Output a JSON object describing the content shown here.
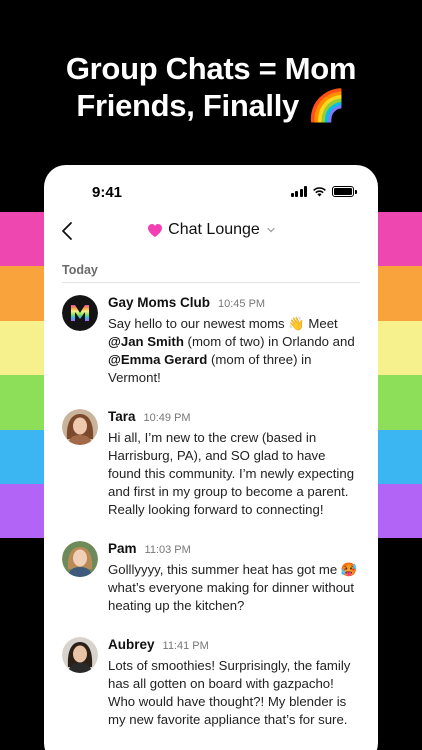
{
  "headline": {
    "line1": "Group Chats = Mom",
    "line2": "Friends, Finally",
    "emoji": "🌈"
  },
  "colors": {
    "stripes": [
      "#ee48b0",
      "#f9a33c",
      "#f6f18c",
      "#8ddf5a",
      "#3cb6f2",
      "#b264f7"
    ],
    "heart": "#f23fb4"
  },
  "status_bar": {
    "time": "9:41"
  },
  "nav": {
    "title": "Chat Lounge",
    "heart_icon": "heart-icon",
    "back_icon": "chevron-left-icon"
  },
  "section": {
    "label": "Today"
  },
  "messages": [
    {
      "name": "Gay Moms Club",
      "time": "10:45 PM",
      "text_before": "Say hello to our newest moms 👋 Meet ",
      "mention1": "@Jan Smith",
      "text_mid": " (mom of two) in Orlando and ",
      "mention2": "@Emma Gerard",
      "text_after": " (mom of three) in Vermont!"
    },
    {
      "name": "Tara",
      "time": "10:49 PM",
      "text": "Hi all, I’m new to the crew (based in Harrisburg, PA), and SO glad to have found this community. I’m newly expecting and first in my group to become a parent. Really looking forward to connecting!"
    },
    {
      "name": "Pam",
      "time": "11:03 PM",
      "text": "Golllyyyy, this summer heat has got me 🥵 what’s everyone making for dinner without heating up the kitchen?"
    },
    {
      "name": "Aubrey",
      "time": "11:41 PM",
      "text": "Lots of smoothies! Surprisingly, the family has all gotten on board with gazpacho! Who would have thought?! My blender is my new favorite appliance that’s for sure."
    }
  ]
}
